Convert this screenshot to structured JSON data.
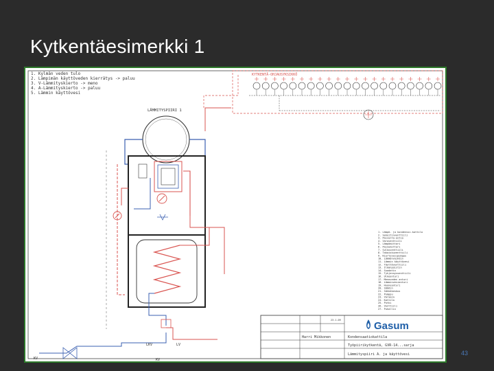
{
  "slide": {
    "title": "Kytkentäesimerkki 1",
    "page_number": "43"
  },
  "diagram": {
    "notes": [
      "1. Kylmän veden tulo",
      "2. Lämpimän käyttöveden kierrätys -> paluu",
      "3. V-Lämmityskierto -> meno",
      "4. A-Lämmityskierto -> paluu",
      "5. Lämmin käyttövesi"
    ],
    "tank_label": "LÄMMITYSPIIRI 1",
    "title_block": {
      "company": "Gasum",
      "designer": "Harri Mikkonen",
      "subject": "Kondensaatiokattila",
      "scheme": "Työpiirikytkentä, GVR-14...sarja",
      "drawing": "Lämmityspiiri A. ja käyttövesi",
      "date": "23.1.09"
    },
    "left_inlet_label": "KV",
    "bottom_label": "KV",
    "legend_lines": [
      "1. Lämpö- ja kondenssi-kattila",
      "2. Sekoitinventtiili",
      "3. Paisunta-astia",
      "4. Varoventtiili",
      "5. Lämpömittari",
      "6. Painemittari",
      "7. Sulkuventtiili",
      "8. Takaiskuventtiili",
      "9. Kiertovesipumppu",
      "10. Lämmönvaihdin",
      "11. Lämmin käyttövesi",
      "12. Täyttöventtiili",
      "13. Ilmanpoistin",
      "14. Suodatin",
      "15. Tyhjennysventtiili",
      "16. Ulkoanturi",
      "17. Menoveden anturi",
      "18. Lämminvesianturi",
      "19. Huoneanturi",
      "20. Säädin",
      "21. Sähkökeskus",
      "22. Pumppu",
      "23. Varaaja",
      "24. Kattila",
      "25. Putki",
      "26. Venttiili",
      "27. Puhallin"
    ]
  }
}
